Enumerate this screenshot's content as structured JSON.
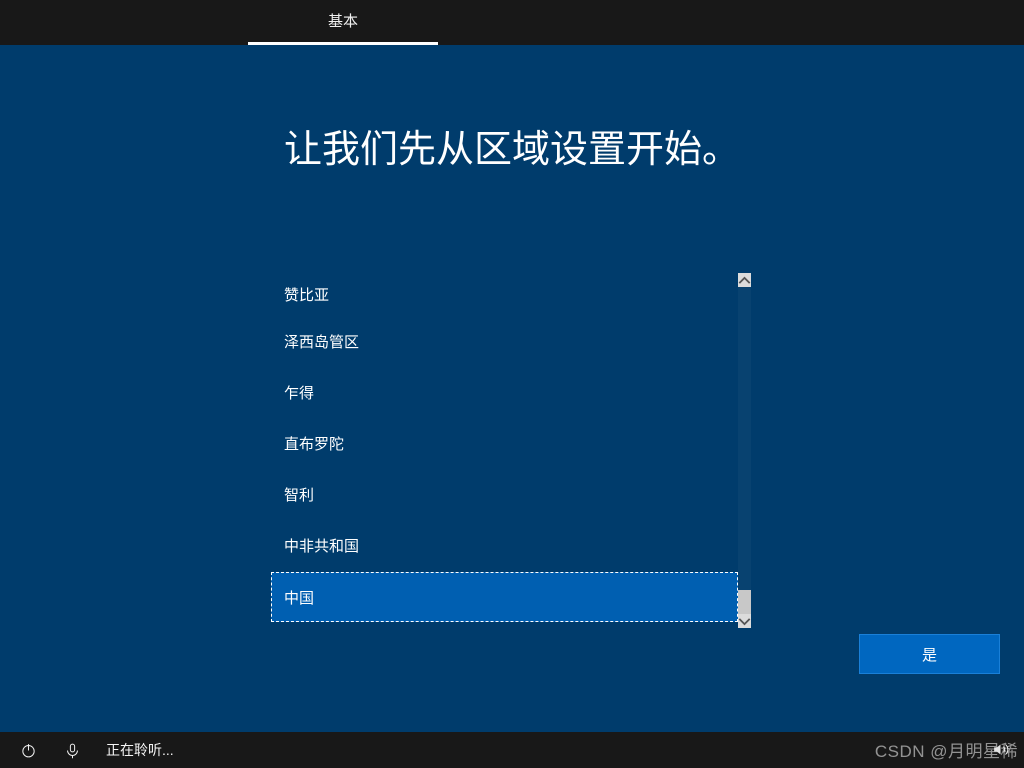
{
  "header": {
    "tab_basic": "基本"
  },
  "main": {
    "heading": "让我们先从区域设置开始。"
  },
  "regions": {
    "items": [
      "赞比亚",
      "泽西岛管区",
      "乍得",
      "直布罗陀",
      "智利",
      "中非共和国",
      "中国"
    ],
    "selected_index": 6
  },
  "buttons": {
    "yes": "是"
  },
  "statusbar": {
    "listening": "正在聆听..."
  },
  "watermark": "CSDN @月明星稀"
}
